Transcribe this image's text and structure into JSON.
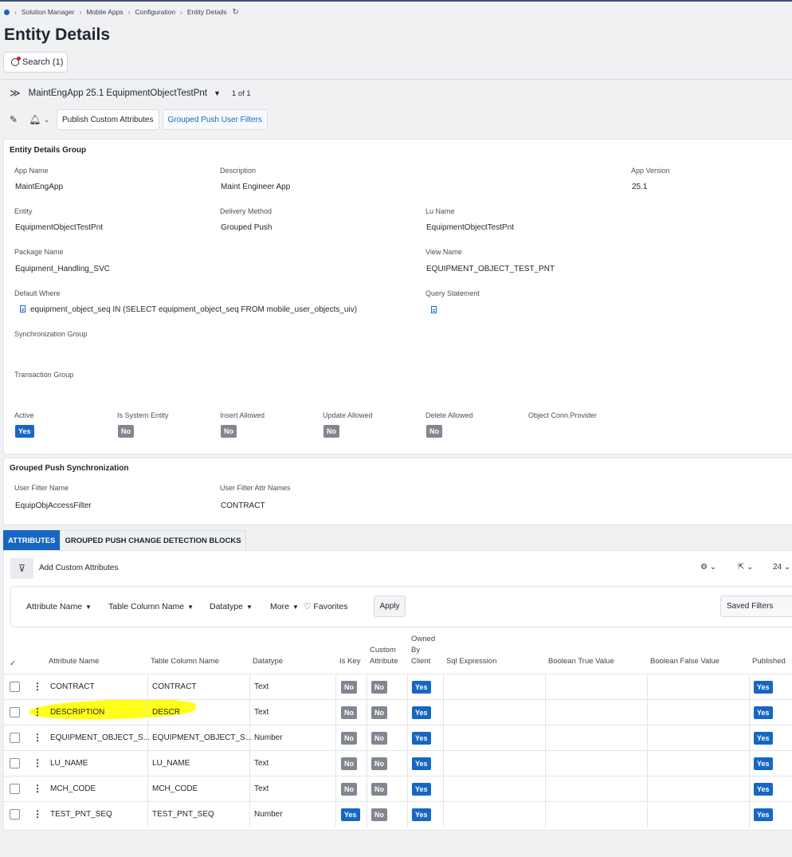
{
  "breadcrumb": [
    "Solution Manager",
    "Mobile Apps",
    "Configuration",
    "Entity Details"
  ],
  "page_title": "Entity Details",
  "search_label": "Search (1)",
  "record": {
    "title": "MaintEngApp 25.1 EquipmentObjectTestPnt",
    "pager": "1 of 1"
  },
  "toolbar": {
    "publish_label": "Publish Custom Attributes",
    "grouped_label": "Grouped Push User Filters"
  },
  "group": {
    "title": "Entity Details Group",
    "fields": {
      "app_name": {
        "label": "App Name",
        "value": "MaintEngApp"
      },
      "description": {
        "label": "Description",
        "value": "Maint Engineer App"
      },
      "app_version": {
        "label": "App Version",
        "value": "25.1"
      },
      "entity": {
        "label": "Entity",
        "value": "EquipmentObjectTestPnt"
      },
      "delivery_method": {
        "label": "Delivery Method",
        "value": "Grouped Push"
      },
      "lu_name": {
        "label": "Lu Name",
        "value": "EquipmentObjectTestPnt"
      },
      "package_name": {
        "label": "Package Name",
        "value": "Equipment_Handling_SVC"
      },
      "view_name": {
        "label": "View Name",
        "value": "EQUIPMENT_OBJECT_TEST_PNT"
      },
      "default_where": {
        "label": "Default Where",
        "value": "equipment_object_seq IN (SELECT equipment_object_seq FROM mobile_user_objects_uiv)"
      },
      "query_statement": {
        "label": "Query Statement"
      },
      "sync_group": {
        "label": "Synchronization Group"
      },
      "transaction_group": {
        "label": "Transaction Group"
      }
    },
    "flags": {
      "active": {
        "label": "Active",
        "value": "Yes"
      },
      "is_system": {
        "label": "Is System Entity",
        "value": "No"
      },
      "insert_allowed": {
        "label": "Insert Allowed",
        "value": "No"
      },
      "update_allowed": {
        "label": "Update Allowed",
        "value": "No"
      },
      "delete_allowed": {
        "label": "Delete Allowed",
        "value": "No"
      },
      "object_conn": {
        "label": "Object Conn.Provider"
      }
    }
  },
  "push_sync": {
    "title": "Grouped Push Synchronization",
    "user_filter_name": {
      "label": "User Filter Name",
      "value": "EquipObjAccessFilter"
    },
    "user_filter_attr": {
      "label": "User Filter Attr Names",
      "value": "CONTRACT"
    }
  },
  "tabs": [
    "ATTRIBUTES",
    "GROUPED PUSH CHANGE DETECTION BLOCKS"
  ],
  "grid": {
    "add_custom": "Add Custom Attributes",
    "page_size": "24",
    "filters": [
      "Attribute Name",
      "Table Column Name",
      "Datatype",
      "More"
    ],
    "favorites": "Favorites",
    "apply": "Apply",
    "saved_filters": "Saved Filters",
    "headers": {
      "attr_name": "Attribute Name",
      "table_col": "Table Column Name",
      "datatype": "Datatype",
      "is_key": "Is Key",
      "custom_attr": "Custom\nAttribute",
      "owned_by_client": "Owned\nBy\nClient",
      "sql_expr": "Sql Expression",
      "bool_true": "Boolean True Value",
      "bool_false": "Boolean False Value",
      "published": "Published"
    },
    "rows": [
      {
        "attr": "CONTRACT",
        "col": "CONTRACT",
        "type": "Text",
        "is_key": "No",
        "custom": "No",
        "owned": "Yes",
        "published": "Yes"
      },
      {
        "attr": "DESCRIPTION",
        "col": "DESCR",
        "type": "Text",
        "is_key": "No",
        "custom": "No",
        "owned": "Yes",
        "published": "Yes"
      },
      {
        "attr": "EQUIPMENT_OBJECT_S...",
        "col": "EQUIPMENT_OBJECT_S...",
        "type": "Number",
        "is_key": "No",
        "custom": "No",
        "owned": "Yes",
        "published": "Yes"
      },
      {
        "attr": "LU_NAME",
        "col": "LU_NAME",
        "type": "Text",
        "is_key": "No",
        "custom": "No",
        "owned": "Yes",
        "published": "Yes"
      },
      {
        "attr": "MCH_CODE",
        "col": "MCH_CODE",
        "type": "Text",
        "is_key": "No",
        "custom": "No",
        "owned": "Yes",
        "published": "Yes"
      },
      {
        "attr": "TEST_PNT_SEQ",
        "col": "TEST_PNT_SEQ",
        "type": "Number",
        "is_key": "Yes",
        "custom": "No",
        "owned": "Yes",
        "published": "Yes"
      }
    ]
  },
  "colors": {
    "accent": "#1667c3",
    "no_badge": "#818690",
    "highlight": "#ffff1a"
  }
}
